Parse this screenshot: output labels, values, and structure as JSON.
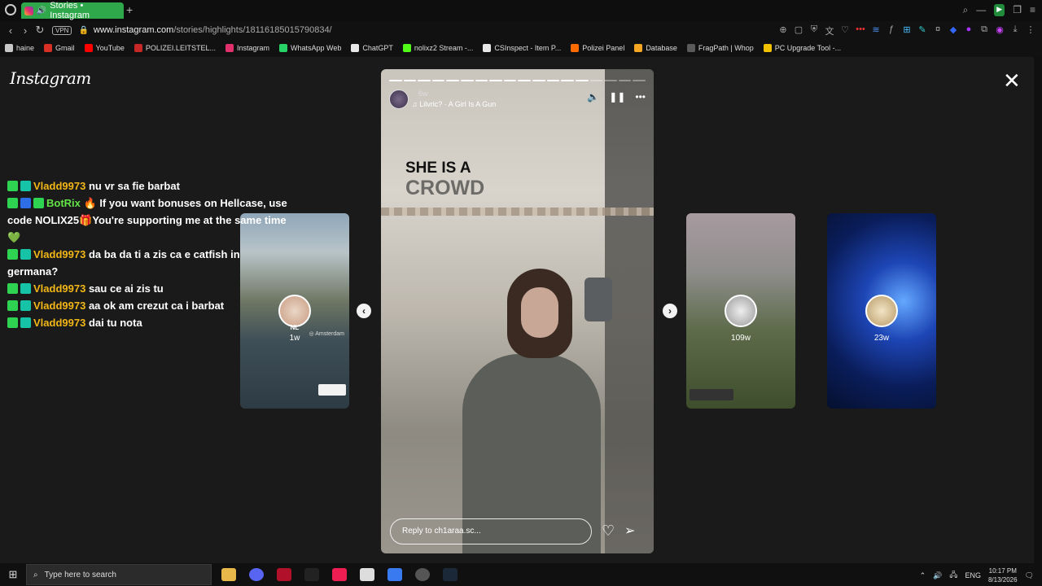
{
  "browser": {
    "tab_title": "Stories • Instagram",
    "new_tab": "+",
    "vpn_label": "VPN",
    "url_host": "www.instagram.com",
    "url_path": "/stories/highlights/18116185015790834/"
  },
  "bookmarks": [
    {
      "label": "haine",
      "color": "#c8c8c8"
    },
    {
      "label": "Gmail",
      "color": "#d93025"
    },
    {
      "label": "YouTube",
      "color": "#ff0000"
    },
    {
      "label": "POLIZEI.LEITSTEL...",
      "color": "#c62828"
    },
    {
      "label": "Instagram",
      "color": "#e1306c"
    },
    {
      "label": "WhatsApp Web",
      "color": "#25d366"
    },
    {
      "label": "ChatGPT",
      "color": "#e8e8e8"
    },
    {
      "label": "nolixz2 Stream -...",
      "color": "#53fc18"
    },
    {
      "label": "CSInspect - Item P...",
      "color": "#e8e8e8"
    },
    {
      "label": "Polizei Panel",
      "color": "#ff6a00"
    },
    {
      "label": "Database",
      "color": "#f5a623"
    },
    {
      "label": "FragPath | Whop",
      "color": "#5a5a5a"
    },
    {
      "label": "PC Upgrade Tool -...",
      "color": "#f2c200"
    }
  ],
  "page": {
    "brand": "Instagram",
    "close_label": "✕"
  },
  "story": {
    "time": "6w",
    "music": "Lilvric? · A Girl Is A Gun",
    "caption_line1": "SHE IS A",
    "caption_line2": "CROWD",
    "reply_placeholder": "Reply to ch1araa.sc...",
    "progress_total": 18,
    "progress_done": 14
  },
  "side_stories": {
    "left": {
      "name": "NL",
      "age": "1w",
      "location": "◎ Amsterdam"
    },
    "right1": {
      "age": "109w"
    },
    "right2": {
      "age": "23w"
    }
  },
  "chat": [
    {
      "badges": [
        "green",
        "teal"
      ],
      "nick": "Vladd9973",
      "nick_color": "yellow",
      "text": "nu vr sa fie barbat"
    },
    {
      "badges": [
        "green",
        "blue",
        "green"
      ],
      "nick": "BotRix",
      "nick_color": "green",
      "text": "🔥 If you want bonuses on Hellcase, use code NOLIX25🎁You're supporting me at the same time💚"
    },
    {
      "badges": [
        "green",
        "teal"
      ],
      "nick": "Vladd9973",
      "nick_color": "yellow",
      "text": "da ba da ti a zis ca e catfish in germana?"
    },
    {
      "badges": [
        "green",
        "teal"
      ],
      "nick": "Vladd9973",
      "nick_color": "yellow",
      "text": "sau ce ai zis tu"
    },
    {
      "badges": [
        "green",
        "teal"
      ],
      "nick": "Vladd9973",
      "nick_color": "yellow",
      "text": "aa ok am crezut ca i barbat"
    },
    {
      "badges": [
        "green",
        "teal"
      ],
      "nick": "Vladd9973",
      "nick_color": "yellow",
      "text": "dai tu nota"
    }
  ],
  "taskbar": {
    "search_placeholder": "Type here to search",
    "language": "ENG",
    "time": "10:17 PM",
    "date": "8/13/2026"
  }
}
